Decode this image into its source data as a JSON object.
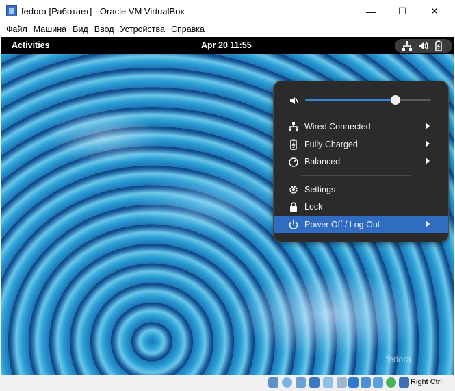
{
  "window": {
    "title": "fedora [Работает] - Oracle VM VirtualBox",
    "controls": {
      "minimize": "—",
      "maximize": "☐",
      "close": "✕"
    }
  },
  "menubar": [
    "Файл",
    "Машина",
    "Вид",
    "Ввод",
    "Устройства",
    "Справка"
  ],
  "gnome": {
    "activities": "Activities",
    "clock": "Apr 20  11:55",
    "tray_icons": [
      "network-icon",
      "speaker-icon",
      "battery-icon"
    ]
  },
  "system_menu": {
    "volume_level": 0.72,
    "items": [
      {
        "label": "Wired Connected",
        "icon": "network-icon",
        "submenu": true
      },
      {
        "label": "Fully Charged",
        "icon": "battery-icon",
        "submenu": true
      },
      {
        "label": "Balanced",
        "icon": "power-profile-icon",
        "submenu": true
      },
      {
        "label": "Settings",
        "icon": "gear-icon",
        "submenu": false
      },
      {
        "label": "Lock",
        "icon": "lock-icon",
        "submenu": false
      },
      {
        "label": "Power Off / Log Out",
        "icon": "power-icon",
        "submenu": true,
        "active": true
      }
    ]
  },
  "desktop": {
    "watermark": "fedora"
  },
  "statusbar": {
    "host_key": "Right Ctrl"
  },
  "colors": {
    "accent": "#3584e4",
    "active_row": "#2f6cc2",
    "menu_bg": "#2b2b2b"
  }
}
